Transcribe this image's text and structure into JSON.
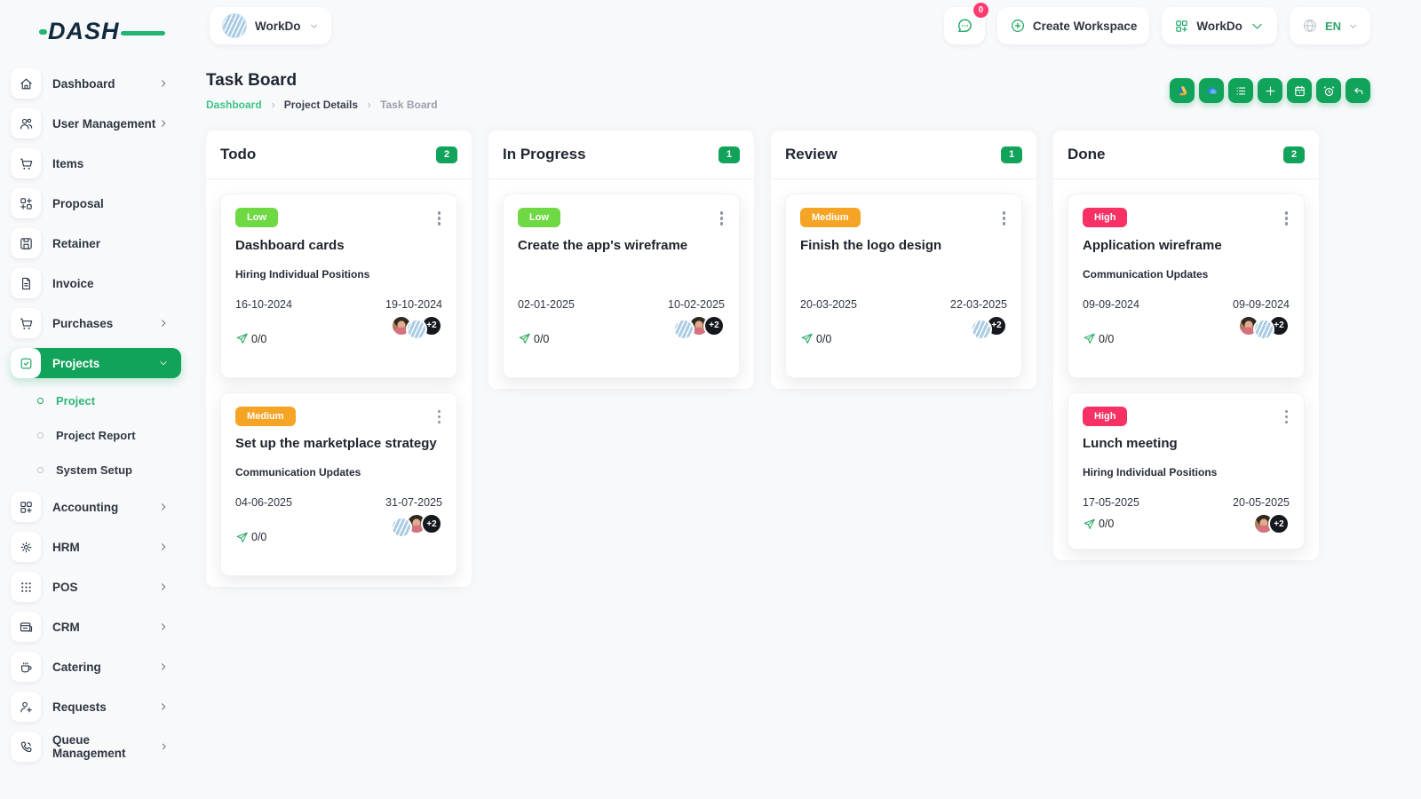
{
  "colors": {
    "primary": "#12A35B",
    "link_green": "#3DC487",
    "low": "#6FD943",
    "medium": "#F6A426",
    "high": "#F73164",
    "notification_red": "#FF3A6E"
  },
  "brand": {
    "name": "DASH"
  },
  "topbar": {
    "workspace_switcher": {
      "label": "WorkDo",
      "icon": "building-avatar"
    },
    "messages": {
      "icon": "chat-icon",
      "badge": "0"
    },
    "create_workspace": {
      "label": "Create Workspace",
      "icon": "plus-circle-icon"
    },
    "workdo_menu": {
      "label": "WorkDo",
      "icon": "grid-icon"
    },
    "language": {
      "label": "EN",
      "icon": "globe-icon"
    }
  },
  "sidebar": {
    "items": [
      {
        "label": "Dashboard",
        "icon": "home-icon",
        "chevron": true,
        "active": false
      },
      {
        "label": "User Management",
        "icon": "users-icon",
        "chevron": true,
        "active": false
      },
      {
        "label": "Items",
        "icon": "cart-icon",
        "chevron": false,
        "active": false
      },
      {
        "label": "Proposal",
        "icon": "proposal-icon",
        "chevron": false,
        "active": false
      },
      {
        "label": "Retainer",
        "icon": "retainer-icon",
        "chevron": false,
        "active": false
      },
      {
        "label": "Invoice",
        "icon": "invoice-icon",
        "chevron": false,
        "active": false
      },
      {
        "label": "Purchases",
        "icon": "cart-icon",
        "chevron": true,
        "active": false
      },
      {
        "label": "Projects",
        "icon": "checkbox-icon",
        "chevron": true,
        "active": true,
        "expanded": true,
        "submenu": [
          {
            "label": "Project",
            "active": true
          },
          {
            "label": "Project Report",
            "active": false
          },
          {
            "label": "System Setup",
            "active": false
          }
        ]
      },
      {
        "label": "Accounting",
        "icon": "grid-plus-icon",
        "chevron": true,
        "active": false
      },
      {
        "label": "HRM",
        "icon": "target-icon",
        "chevron": true,
        "active": false
      },
      {
        "label": "POS",
        "icon": "dots-grid-icon",
        "chevron": true,
        "active": false
      },
      {
        "label": "CRM",
        "icon": "browser-icon",
        "chevron": true,
        "active": false
      },
      {
        "label": "Catering",
        "icon": "coffee-icon",
        "chevron": true,
        "active": false
      },
      {
        "label": "Requests",
        "icon": "user-plus-icon",
        "chevron": true,
        "active": false
      },
      {
        "label": "Queue Management",
        "icon": "phone-call-icon",
        "chevron": true,
        "active": false
      }
    ]
  },
  "page": {
    "title": "Task Board",
    "breadcrumb": [
      {
        "label": "Dashboard",
        "type": "link"
      },
      {
        "label": "Project Details",
        "type": "mid"
      },
      {
        "label": "Task Board",
        "type": "current"
      }
    ]
  },
  "toolbar": [
    {
      "name": "google-drive-button",
      "icon": "google-drive-icon"
    },
    {
      "name": "onedrive-button",
      "icon": "onedrive-icon"
    },
    {
      "name": "list-view-button",
      "icon": "list-icon"
    },
    {
      "name": "add-task-button",
      "icon": "plus-icon"
    },
    {
      "name": "calendar-button",
      "icon": "calendar-icon"
    },
    {
      "name": "reminder-button",
      "icon": "alarm-icon"
    },
    {
      "name": "back-button",
      "icon": "undo-icon"
    }
  ],
  "board": {
    "columns": [
      {
        "title": "Todo",
        "count": "2",
        "cards": [
          {
            "priority": "Low",
            "priority_key": "low",
            "title": "Dashboard cards",
            "milestone": "Hiring Individual Positions",
            "start_date": "16-10-2024",
            "due_date": "19-10-2024",
            "progress": "0/0",
            "avatars": [
              "photo",
              "logo"
            ],
            "more": "+2"
          },
          {
            "priority": "Medium",
            "priority_key": "medium",
            "title": "Set up the marketplace strategy",
            "milestone": "Communication Updates",
            "start_date": "04-06-2025",
            "due_date": "31-07-2025",
            "progress": "0/0",
            "avatars": [
              "logo",
              "photo"
            ],
            "more": "+2"
          }
        ]
      },
      {
        "title": "In Progress",
        "count": "1",
        "cards": [
          {
            "priority": "Low",
            "priority_key": "low",
            "title": "Create the app's wireframe",
            "milestone": "",
            "start_date": "02-01-2025",
            "due_date": "10-02-2025",
            "progress": "0/0",
            "avatars": [
              "logo",
              "photo"
            ],
            "more": "+2"
          }
        ]
      },
      {
        "title": "Review",
        "count": "1",
        "cards": [
          {
            "priority": "Medium",
            "priority_key": "medium",
            "title": "Finish the logo design",
            "milestone": "",
            "start_date": "20-03-2025",
            "due_date": "22-03-2025",
            "progress": "0/0",
            "avatars": [
              "logo"
            ],
            "more": "+2"
          }
        ]
      },
      {
        "title": "Done",
        "count": "2",
        "cards": [
          {
            "priority": "High",
            "priority_key": "high",
            "title": "Application wireframe",
            "milestone": "Communication Updates",
            "start_date": "09-09-2024",
            "due_date": "09-09-2024",
            "progress": "0/0",
            "avatars": [
              "photo",
              "logo"
            ],
            "more": "+2"
          },
          {
            "priority": "High",
            "priority_key": "high",
            "title": "Lunch meeting",
            "milestone": "Hiring Individual Positions",
            "start_date": "17-05-2025",
            "due_date": "20-05-2025",
            "progress": "0/0",
            "avatars": [
              "photo"
            ],
            "more": "+2"
          }
        ]
      }
    ]
  }
}
